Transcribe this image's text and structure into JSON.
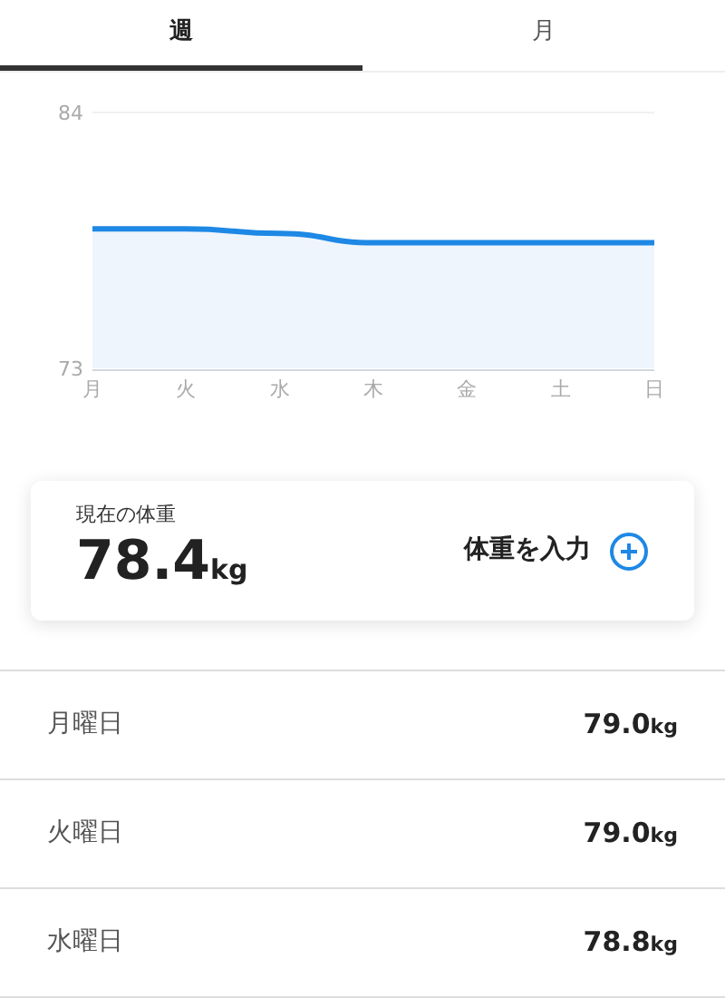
{
  "tabs": [
    {
      "label": "週",
      "selected": true
    },
    {
      "label": "月",
      "selected": false
    }
  ],
  "chart": {
    "chart_data": {
      "type": "area",
      "categories": [
        "月",
        "火",
        "水",
        "木",
        "金",
        "土",
        "日"
      ],
      "ylim": [
        73,
        84
      ],
      "yticks": [
        73,
        84
      ],
      "series": [
        {
          "color": "#1e88e5",
          "values": [
            79.0,
            79.0,
            78.8,
            78.4,
            78.4,
            78.4,
            78.4
          ]
        }
      ]
    }
  },
  "current": {
    "label": "現在の体重",
    "value": "78.4",
    "unit": "kg",
    "action": "体重を入力"
  },
  "entries": [
    {
      "day": "月曜日",
      "value": "79.0",
      "unit": "kg"
    },
    {
      "day": "火曜日",
      "value": "79.0",
      "unit": "kg"
    },
    {
      "day": "水曜日",
      "value": "78.8",
      "unit": "kg"
    }
  ]
}
